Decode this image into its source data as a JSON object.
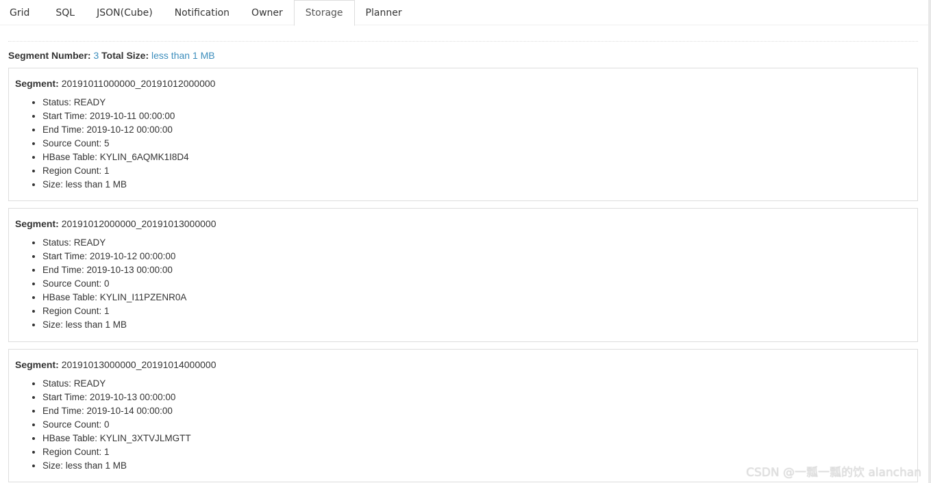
{
  "tabs": [
    {
      "label": "Grid"
    },
    {
      "label": "SQL"
    },
    {
      "label": "JSON(Cube)"
    },
    {
      "label": "Notification"
    },
    {
      "label": "Owner"
    },
    {
      "label": "Storage",
      "active": true
    },
    {
      "label": "Planner"
    }
  ],
  "summary": {
    "segment_number_label": "Segment Number:",
    "segment_number_value": "3",
    "total_size_label": "Total Size:",
    "total_size_value": "less than 1 MB"
  },
  "segment_label": "Segment:",
  "segments": [
    {
      "name": "20191011000000_20191012000000",
      "fields": [
        "Status: READY",
        "Start Time: 2019-10-11 00:00:00",
        "End Time: 2019-10-12 00:00:00",
        "Source Count: 5",
        "HBase Table: KYLIN_6AQMK1I8D4",
        "Region Count: 1",
        "Size: less than 1 MB"
      ]
    },
    {
      "name": "20191012000000_20191013000000",
      "fields": [
        "Status: READY",
        "Start Time: 2019-10-12 00:00:00",
        "End Time: 2019-10-13 00:00:00",
        "Source Count: 0",
        "HBase Table: KYLIN_I11PZENR0A",
        "Region Count: 1",
        "Size: less than 1 MB"
      ]
    },
    {
      "name": "20191013000000_20191014000000",
      "fields": [
        "Status: READY",
        "Start Time: 2019-10-13 00:00:00",
        "End Time: 2019-10-14 00:00:00",
        "Source Count: 0",
        "HBase Table: KYLIN_3XTVJLMGTT",
        "Region Count: 1",
        "Size: less than 1 MB"
      ]
    }
  ],
  "watermark": "CSDN @一瓢一瓢的饮 alanchan"
}
